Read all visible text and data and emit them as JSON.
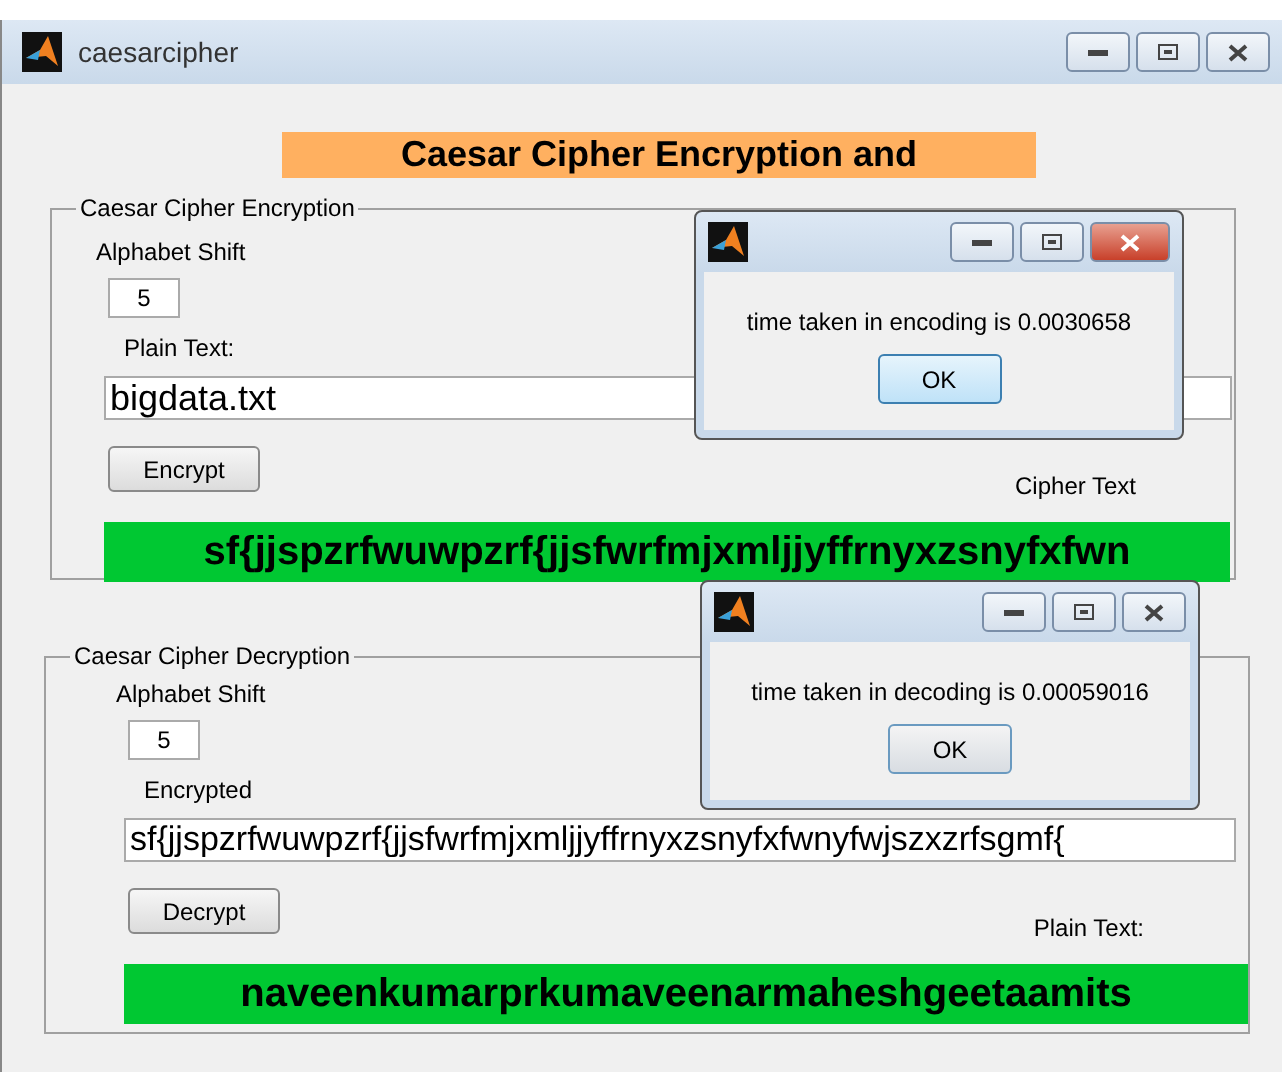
{
  "window": {
    "title": "caesarcipher"
  },
  "banner": "Caesar Cipher Encryption and",
  "encryption": {
    "title": "Caesar Cipher Encryption",
    "shift_label": "Alphabet Shift",
    "shift": "5",
    "input_label": "Plain Text:",
    "input": "bigdata.txt",
    "button": "Encrypt",
    "output_label": "Cipher Text",
    "output": "sf{jjspzrfwuwpzrf{jjsfwrfmjxmljjyffrnyxzsnyfxfwn"
  },
  "decryption": {
    "title": "Caesar Cipher Decryption",
    "shift_label": "Alphabet Shift",
    "shift": "5",
    "input_label": "Encrypted",
    "input": "sf{jjspzrfwuwpzrf{jjsfwrfmjxmljjyffrnyxzsnyfxfwnyfwjszxzrfsgmf{",
    "button": "Decrypt",
    "output_label": "Plain Text:",
    "output": "naveenkumarprkumaveenarmaheshgeetaamits"
  },
  "dialogs": [
    {
      "message": "time taken in encoding is 0.0030658",
      "button": "OK",
      "active": true
    },
    {
      "message": "time taken in decoding is 0.00059016",
      "button": "OK",
      "active": false
    }
  ]
}
